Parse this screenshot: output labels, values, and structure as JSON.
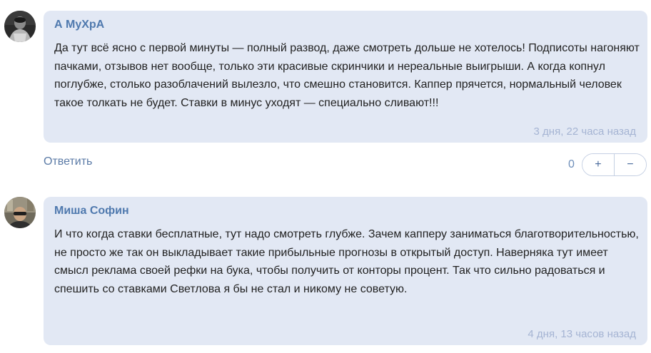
{
  "comments": [
    {
      "author": "А МуХрА",
      "text": "Да тут всё ясно с первой минуты — полный развод, даже смотреть дольше не хотелось! Подписоты нагоняют пачками, отзывов нет вообще, только эти красивые скринчики и нереальные выигрыши. А когда копнул поглубже, столько разоблачений вылезло, что смешно становится. Каппер прячется, нормальный человек такое толкать не будет. Ставки в минус уходят — специально сливают!!!",
      "time": "3 дня, 22 часа назад",
      "reply_label": "Ответить",
      "vote_count": "0",
      "plus_label": "+",
      "minus_label": "−"
    },
    {
      "author": "Миша Софин",
      "text": "И что когда ставки бесплатные, тут надо смотреть глубже. Зачем капперу заниматься благотворительностью, не просто же так он выкладывает такие прибыльные прогнозы в открытый доступ. Наверняка тут имеет смысл реклама своей рефки на бука, чтобы получить от конторы процент. Так что сильно радоваться и спешить со ставками Светлова я бы не стал и никому не советую.",
      "time": "4 дня, 13 часов назад"
    }
  ],
  "colors": {
    "bubble": "#e2e8f4",
    "author": "#4f79ae",
    "timestamp": "#a5b4d3",
    "link": "#5a7aa6"
  }
}
